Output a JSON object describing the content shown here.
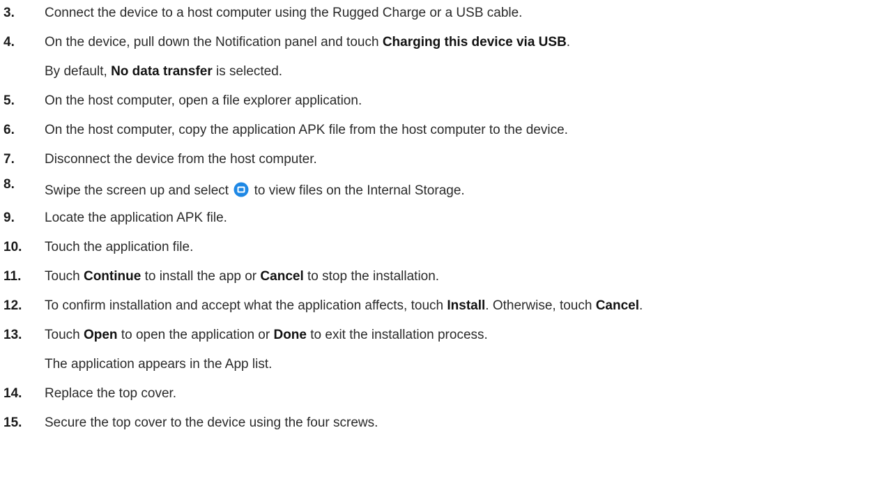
{
  "steps": [
    {
      "number": "3.",
      "text": "Connect the device to a host computer using the Rugged Charge or a USB cable."
    },
    {
      "number": "4.",
      "pre": "On the device, pull down the Notification panel and touch ",
      "bold": "Charging this device via USB",
      "post": "."
    },
    {
      "note_pre": "By default, ",
      "note_bold": "No data transfer",
      "note_post": " is selected."
    },
    {
      "number": "5.",
      "text": "On the host computer, open a file explorer application."
    },
    {
      "number": "6.",
      "text": "On the host computer, copy the application APK file from the host computer to the device."
    },
    {
      "number": "7.",
      "text": "Disconnect the device from the host computer."
    },
    {
      "number": "8.",
      "pre": "Swipe the screen up and select ",
      "icon": "files-app-icon",
      "post": " to view files on the Internal Storage."
    },
    {
      "number": "9.",
      "text": "Locate the application APK file."
    },
    {
      "number": "10.",
      "text": "Touch the application file."
    },
    {
      "number": "11.",
      "pre": "Touch ",
      "bold1": "Continue",
      "mid": " to install the app or ",
      "bold2": "Cancel",
      "post": " to stop the installation."
    },
    {
      "number": "12.",
      "pre": "To confirm installation and accept what the application affects, touch ",
      "bold1": "Install",
      "mid": ". Otherwise, touch ",
      "bold2": "Cancel",
      "post": "."
    },
    {
      "number": "13.",
      "pre": "Touch ",
      "bold1": "Open",
      "mid": " to open the application or ",
      "bold2": "Done",
      "post": " to exit the installation process."
    },
    {
      "note": "The application appears in the App list."
    },
    {
      "number": "14.",
      "text": "Replace the top cover."
    },
    {
      "number": "15.",
      "text": "Secure the top cover to the device using the four screws."
    }
  ],
  "colors": {
    "icon_blue": "#1e88e5",
    "text": "#2a2a2a"
  }
}
